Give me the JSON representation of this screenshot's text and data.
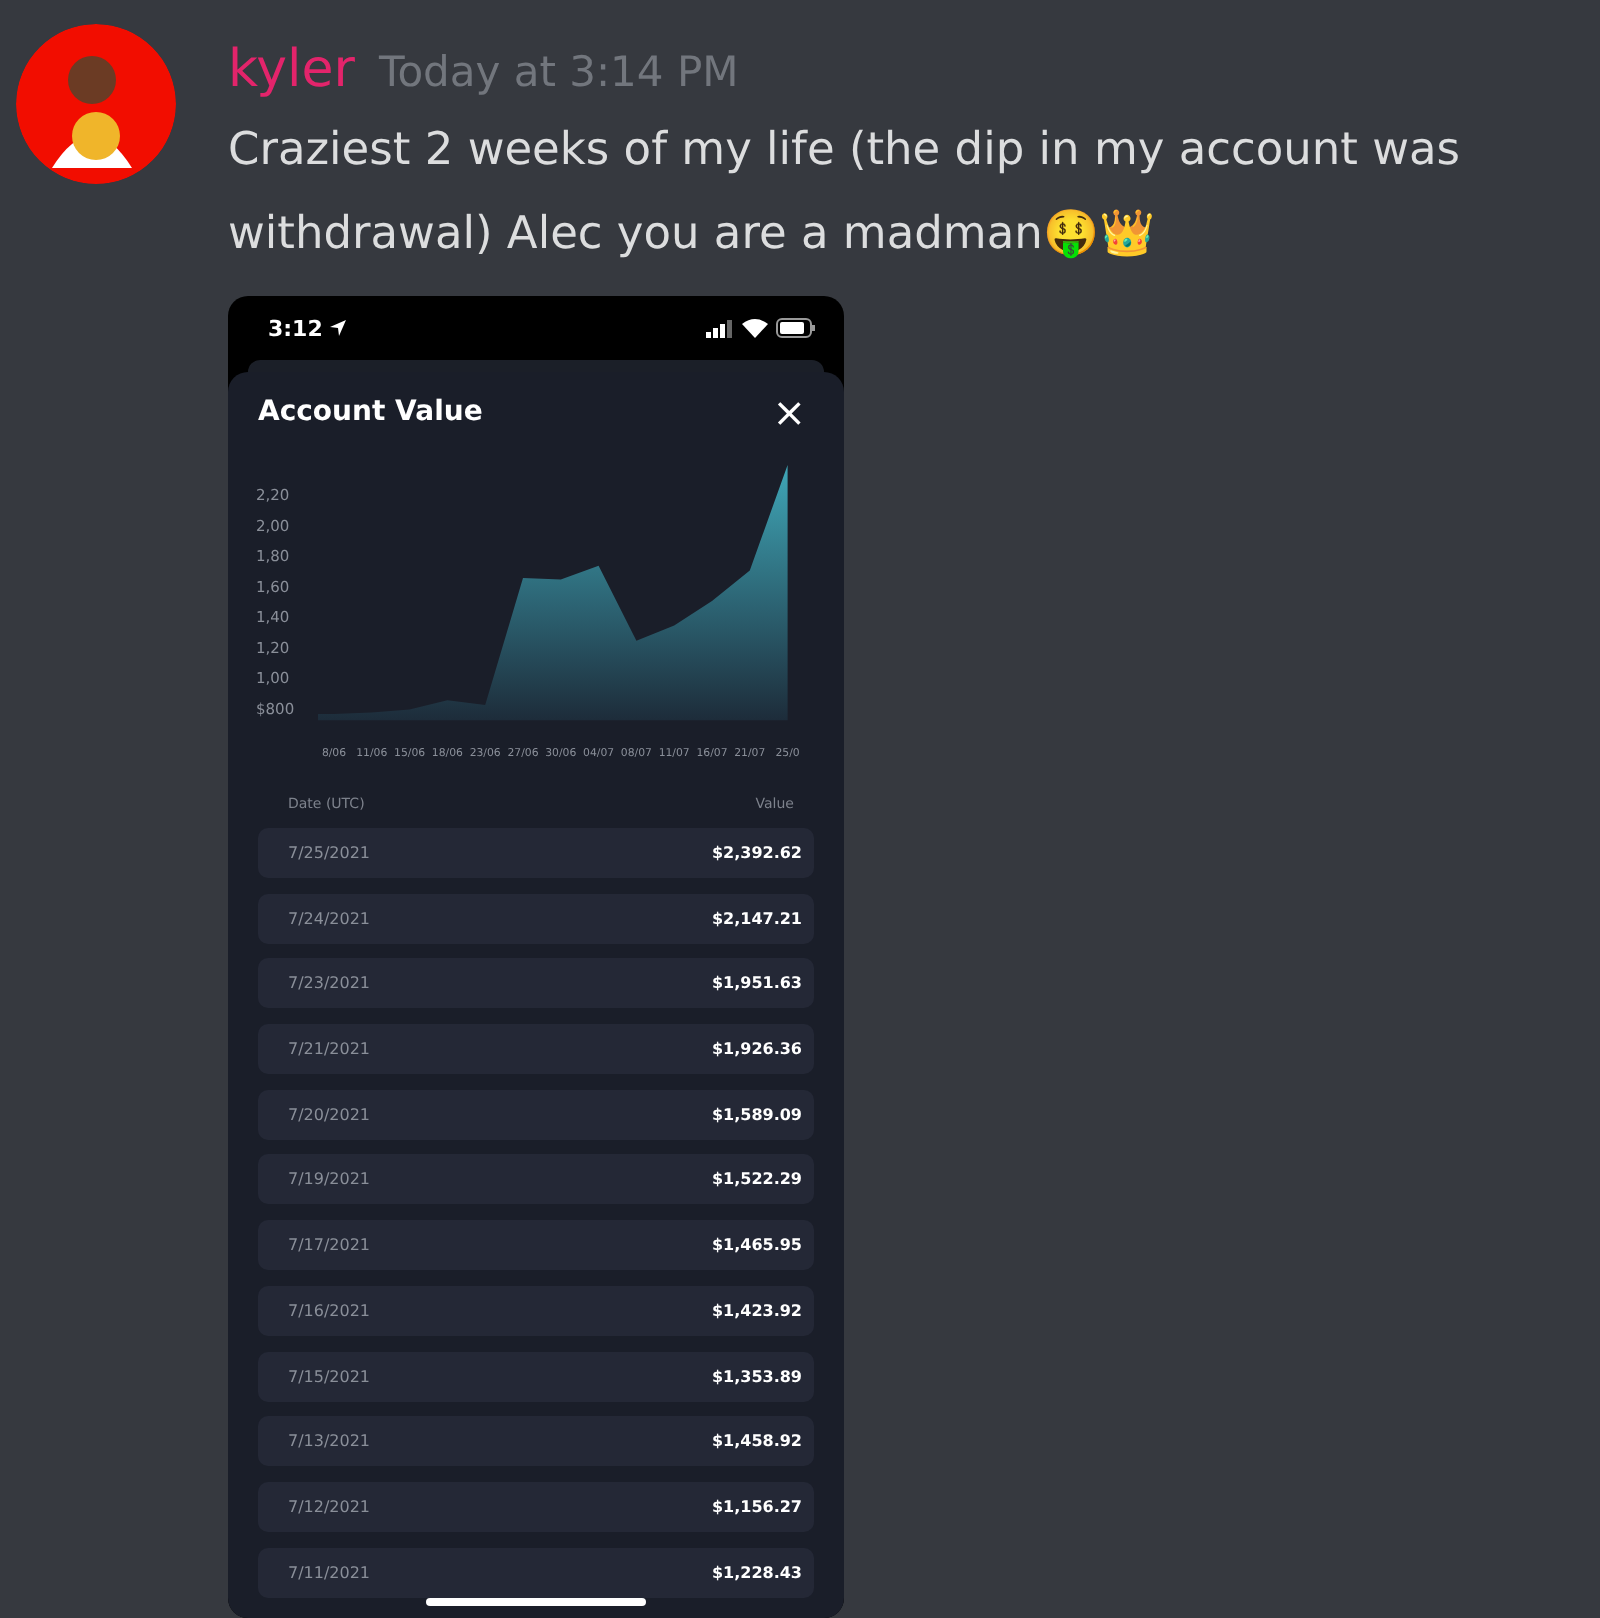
{
  "message": {
    "author": "kyler",
    "timestamp": "Today at 3:14 PM",
    "text": "Craziest 2 weeks of my life (the dip in my account was withdrawal) Alec you are a madman🤑👑"
  },
  "phone": {
    "status_bar": {
      "time": "3:12"
    },
    "sheet": {
      "title": "Account Value",
      "close": "×",
      "chart": {
        "x_labels": [
          "8/06",
          "11/06",
          "15/06",
          "18/06",
          "23/06",
          "27/06",
          "30/06",
          "04/07",
          "08/07",
          "11/07",
          "16/07",
          "21/07",
          "25/0"
        ],
        "y_labels": [
          "2,20",
          "2,00",
          "1,80",
          "1,60",
          "1,40",
          "1,20",
          "1,00",
          "$800"
        ]
      },
      "columns": [
        "Date (UTC)",
        "Value"
      ],
      "rows": [
        {
          "date": "7/25/2021",
          "value": "$2,392.62"
        },
        {
          "date": "7/24/2021",
          "value": "$2,147.21"
        },
        {
          "date": "7/23/2021",
          "value": "$1,951.63"
        },
        {
          "date": "7/21/2021",
          "value": "$1,926.36"
        },
        {
          "date": "7/20/2021",
          "value": "$1,589.09"
        },
        {
          "date": "7/19/2021",
          "value": "$1,522.29"
        },
        {
          "date": "7/17/2021",
          "value": "$1,465.95"
        },
        {
          "date": "7/16/2021",
          "value": "$1,423.92"
        },
        {
          "date": "7/15/2021",
          "value": "$1,353.89"
        },
        {
          "date": "7/13/2021",
          "value": "$1,458.92"
        },
        {
          "date": "7/12/2021",
          "value": "$1,156.27"
        },
        {
          "date": "7/11/2021",
          "value": "$1,228.43"
        }
      ]
    }
  }
}
